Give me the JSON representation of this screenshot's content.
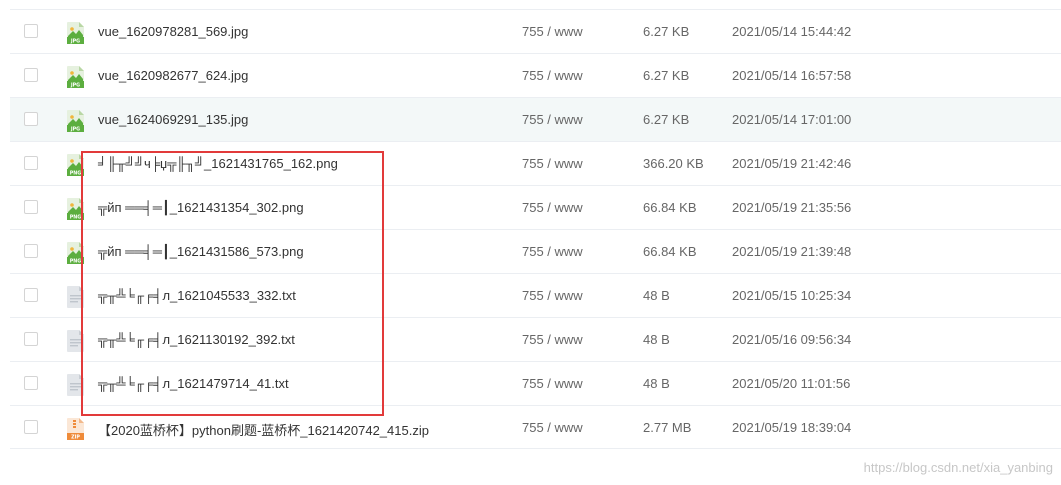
{
  "files": [
    {
      "name": "vue_1620978281_569.jpg",
      "permission": "755 / www",
      "size": "6.27 KB",
      "modified": "2021/05/14 15:44:42",
      "icon": "jpg-file-icon",
      "type_label": "JPG"
    },
    {
      "name": "vue_1620982677_624.jpg",
      "permission": "755 / www",
      "size": "6.27 KB",
      "modified": "2021/05/14 16:57:58",
      "icon": "jpg-file-icon",
      "type_label": "JPG"
    },
    {
      "name": "vue_1624069291_135.jpg",
      "permission": "755 / www",
      "size": "6.27 KB",
      "modified": "2021/05/14 17:01:00",
      "icon": "jpg-file-icon",
      "type_label": "JPG"
    },
    {
      "name": "╛╟╥╝╝ч╞џ╦╟╖╝_1621431765_162.png",
      "permission": "755 / www",
      "size": "366.20 KB",
      "modified": "2021/05/19 21:42:46",
      "icon": "png-file-icon",
      "type_label": "PNG"
    },
    {
      "name": "╦йп ══╡═┃_1621431354_302.png",
      "permission": "755 / www",
      "size": "66.84 KB",
      "modified": "2021/05/19 21:35:56",
      "icon": "png-file-icon",
      "type_label": "PNG"
    },
    {
      "name": "╦йп ══╡═┃_1621431586_573.png",
      "permission": "755 / www",
      "size": "66.84 KB",
      "modified": "2021/05/19 21:39:48",
      "icon": "png-file-icon",
      "type_label": "PNG"
    },
    {
      "name": "╦╥╩╘╓╒╡л_1621045533_332.txt",
      "permission": "755 / www",
      "size": "48 B",
      "modified": "2021/05/15 10:25:34",
      "icon": "txt-file-icon",
      "type_label": ""
    },
    {
      "name": "╦╥╩╘╓╒╡л_1621130192_392.txt",
      "permission": "755 / www",
      "size": "48 B",
      "modified": "2021/05/16 09:56:34",
      "icon": "txt-file-icon",
      "type_label": ""
    },
    {
      "name": "╦╥╩╘╓╒╡л_1621479714_41.txt",
      "permission": "755 / www",
      "size": "48 B",
      "modified": "2021/05/20 11:01:56",
      "icon": "txt-file-icon",
      "type_label": ""
    },
    {
      "name": "【2020蓝桥杯】python刷题-蓝桥杯_1621420742_415.zip",
      "permission": "755 / www",
      "size": "2.77 MB",
      "modified": "2021/05/19 18:39:04",
      "icon": "zip-file-icon",
      "type_label": "ZIP"
    }
  ],
  "hovered_row": 2,
  "colors": {
    "highlight_border": "#e23a3a",
    "image_icon_green": "#5cae3f",
    "zip_icon_orange": "#ef8b3a",
    "txt_icon_gray": "#d9dde2",
    "row_hover": "#f3f8f8"
  },
  "watermark": "https://blog.csdn.net/xia_yanbing"
}
